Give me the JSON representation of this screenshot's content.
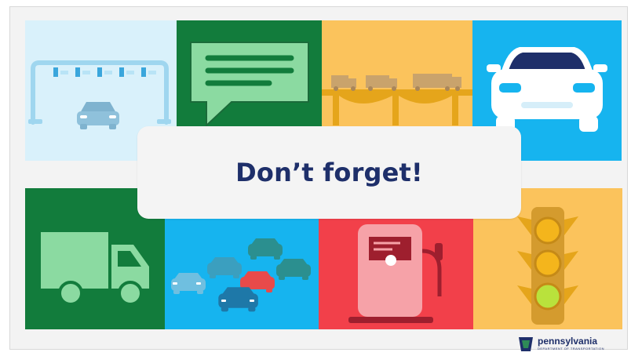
{
  "banner": {
    "title": "Don’t forget!"
  },
  "logo": {
    "name": "pennsylvania",
    "department": "DEPARTMENT OF TRANSPORTATION"
  },
  "tiles": {
    "top": [
      "toll-gantry-car-icon",
      "speech-bubble-icon",
      "trucks-bridge-icon",
      "car-front-icon"
    ],
    "bottom": [
      "box-truck-icon",
      "traffic-jam-icon",
      "fuel-pump-icon",
      "traffic-light-icon"
    ]
  },
  "colors": {
    "navy": "#1e2f6a",
    "light_blue": "#d9f1fb",
    "dark_green": "#127c3c",
    "amber": "#fbc35c",
    "sky_blue": "#16b4ef",
    "red": "#f2404a"
  }
}
